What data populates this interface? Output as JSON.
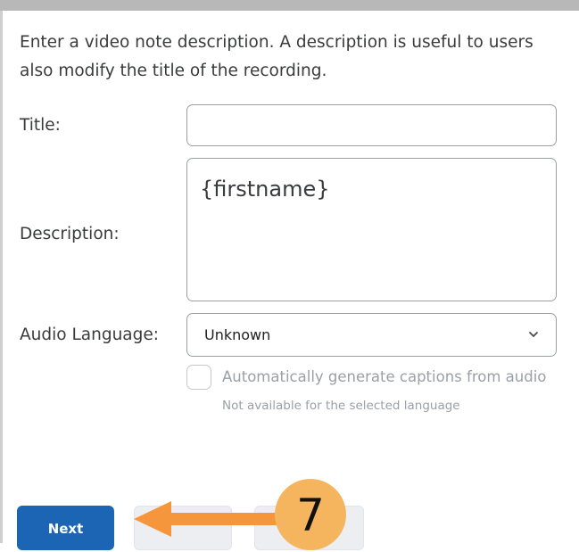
{
  "intro": {
    "line1": "Enter a video note description. A description is useful to users",
    "line2": "also modify the title of the recording."
  },
  "form": {
    "title_label": "Title:",
    "title_value": "",
    "description_label": "Description:",
    "description_value": "{firstname}",
    "audio_language_label": "Audio Language:",
    "audio_language_value": "Unknown",
    "captions_label": "Automatically generate captions from audio",
    "captions_hint": "Not available for the selected language",
    "captions_checked": false
  },
  "buttons": {
    "next_label": "Next"
  },
  "annotation": {
    "step_number": "7"
  },
  "colors": {
    "primary_button": "#1b65b4",
    "annotation_orange": "#f5963c",
    "step_badge": "#f5b55f"
  },
  "icons": {
    "select": "chevron-down-icon",
    "annotation": "arrow-left-icon"
  }
}
